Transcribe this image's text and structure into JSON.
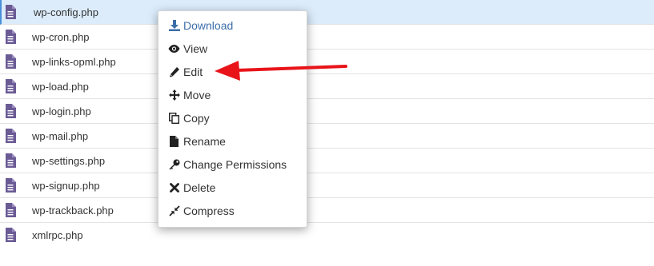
{
  "files": [
    {
      "name": "wp-config.php",
      "selected": true
    },
    {
      "name": "wp-cron.php"
    },
    {
      "name": "wp-links-opml.php"
    },
    {
      "name": "wp-load.php"
    },
    {
      "name": "wp-login.php"
    },
    {
      "name": "wp-mail.php"
    },
    {
      "name": "wp-settings.php"
    },
    {
      "name": "wp-signup.php"
    },
    {
      "name": "wp-trackback.php"
    },
    {
      "name": "xmlrpc.php"
    }
  ],
  "context_menu": {
    "items": [
      {
        "label": "Download",
        "icon": "download-icon"
      },
      {
        "label": "View",
        "icon": "eye-icon"
      },
      {
        "label": "Edit",
        "icon": "pencil-icon"
      },
      {
        "label": "Move",
        "icon": "move-arrows-icon"
      },
      {
        "label": "Copy",
        "icon": "copy-icon"
      },
      {
        "label": "Rename",
        "icon": "file-icon"
      },
      {
        "label": "Change Permissions",
        "icon": "key-icon"
      },
      {
        "label": "Delete",
        "icon": "x-icon"
      },
      {
        "label": "Compress",
        "icon": "compress-icon"
      }
    ]
  },
  "colors": {
    "file_icon": "#6b5b95",
    "selected_row": "#dcecfb",
    "link_blue": "#3c6ea8",
    "arrow_red": "#e8141a"
  }
}
